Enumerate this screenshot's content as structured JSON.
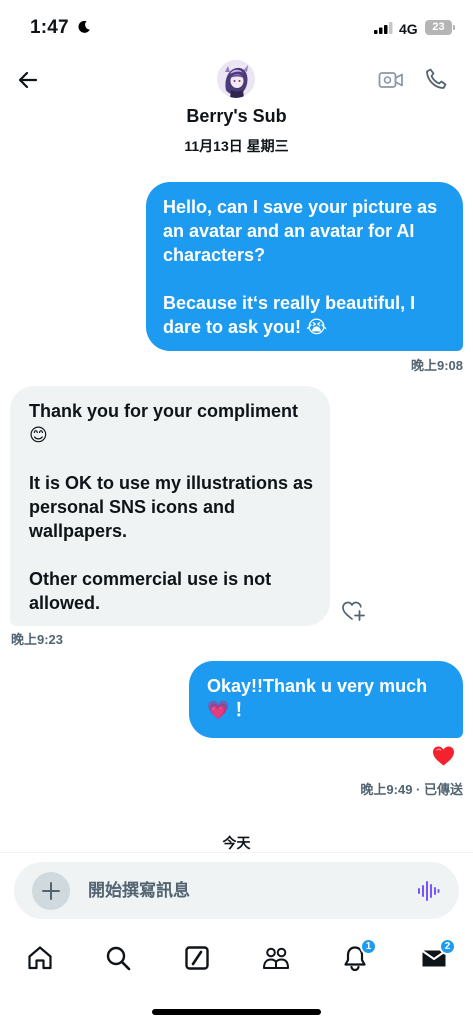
{
  "status_bar": {
    "time": "1:47",
    "network": "4G",
    "battery": "23"
  },
  "header": {
    "contact_name": "Berry's Sub",
    "date": "11月13日 星期三"
  },
  "messages": [
    {
      "direction": "outgoing",
      "text": "Hello, can I save your picture as an avatar and an avatar for AI characters?\n\nBecause it‘s really beautiful, I dare to ask you! 😭",
      "time": "晚上9:08"
    },
    {
      "direction": "incoming",
      "text": "Thank you for your compliment😊\n\nIt is OK to use my illustrations as personal SNS icons and wallpapers.\n\nOther commercial use is not allowed.",
      "time": "晚上9:23"
    },
    {
      "direction": "outgoing",
      "text": "Okay!!Thank u very much 💗 ！",
      "time": "晚上9:49 · 已傳送",
      "reaction": "❤️"
    }
  ],
  "day_divider": "今天",
  "composer": {
    "placeholder": "開始撰寫訊息"
  },
  "tab_bar": {
    "notifications_badge": "1",
    "messages_badge": "2"
  },
  "colors": {
    "accent": "#1d9bf0",
    "incoming_bubble": "#eff3f4",
    "text_secondary": "#536471",
    "voice_accent": "#7856ff"
  }
}
